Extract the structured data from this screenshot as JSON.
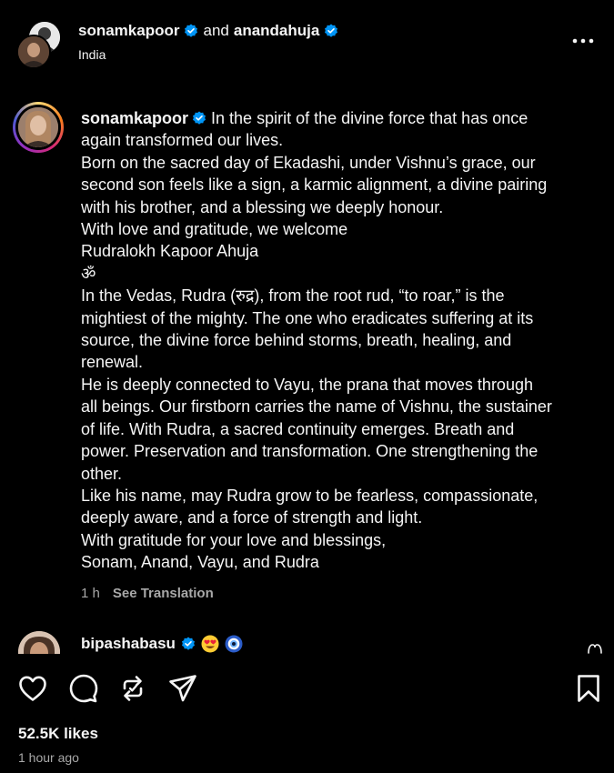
{
  "colors": {
    "background": "#000000",
    "text": "#f5f5f5",
    "muted": "#a8a8a8",
    "verified": "#0095f6"
  },
  "header": {
    "user1": "sonamkapoor",
    "conjunction": "and",
    "user2": "anandahuja",
    "location": "India",
    "more_icon": "more-horizontal-icon"
  },
  "caption": {
    "username": "sonamkapoor",
    "first_line": "In the spirit of the divine force that has once",
    "lines": [
      "again transformed our lives.",
      "Born on the sacred day of Ekadashi, under Vishnu’s grace, our",
      "second son feels like a sign, a karmic alignment, a divine pairing",
      "with his brother, and a blessing we deeply honour.",
      "With love and gratitude, we welcome",
      "Rudralokh Kapoor Ahuja",
      "ॐ",
      "In the Vedas, Rudra (रुद्र), from the root rud, “to roar,” is the",
      "mightiest of the mighty. The one who eradicates suffering at its",
      "source, the divine force behind storms, breath, healing, and",
      "renewal.",
      "He is deeply connected to Vayu, the prana that moves through",
      "all beings. Our firstborn carries the name of Vishnu, the sustainer",
      "of life. With Rudra, a sacred continuity emerges. Breath and",
      "power. Preservation and transformation. One strengthening the",
      "other.",
      "Like his name, may Rudra grow to be fearless, compassionate,",
      "deeply aware, and a force of strength and light.",
      "With gratitude for your love and blessings,",
      "Sonam, Anand, Vayu, and Rudra"
    ],
    "time_ago": "1 h",
    "see_translation": "See Translation"
  },
  "comment": {
    "username": "bipashabasu",
    "emojis": [
      "heart-eyes-emoji",
      "evil-eye-emoji"
    ],
    "like_icon": "heart-outline-icon"
  },
  "actions": {
    "icons": [
      "like-icon",
      "comment-icon",
      "repost-icon",
      "share-icon",
      "save-icon"
    ]
  },
  "stats": {
    "likes": "52.5K likes",
    "posted": "1 hour ago"
  }
}
